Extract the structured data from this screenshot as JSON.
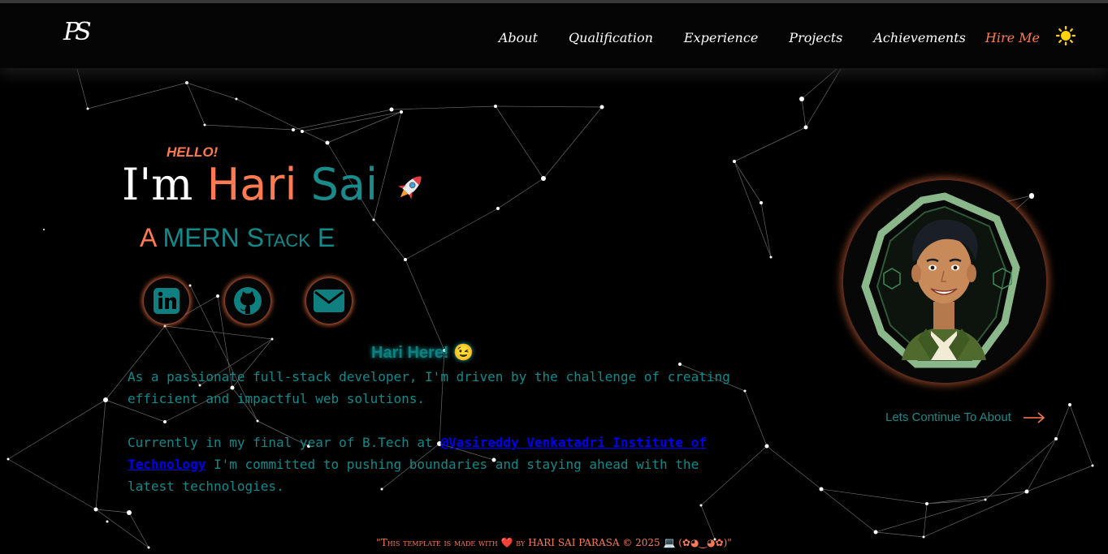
{
  "nav": {
    "logo": "PS",
    "links": [
      "About",
      "Qualification",
      "Experience",
      "Projects",
      "Achievements"
    ],
    "hire": "Hire Me",
    "theme_icon": "sun-icon"
  },
  "hero": {
    "hello": "HELLO!",
    "im": "I'm",
    "first_name": "Hari",
    "last_name": "Sai",
    "role_prefix": "A",
    "role_text": "MERN Stack E"
  },
  "social": [
    {
      "name": "linkedin-icon"
    },
    {
      "name": "github-icon"
    },
    {
      "name": "mail-icon"
    }
  ],
  "about": {
    "greeting": "Hari Here! 😉",
    "para1": "As a passionate full-stack developer, I'm driven by the challenge of creating efficient and impactful web solutions.",
    "para2_pre": "Currently in my final year of B.Tech at ",
    "para2_link": "@Vasireddy Venkatadri Institute of Technology",
    "para2_post": " I'm committed to pushing boundaries and staying ahead with the latest technologies."
  },
  "continue_label": "Lets Continue To About",
  "footer": "\"This template is made with ❤️ by HARI SAI PARASA © 2025 💻 (✿◕‿◕✿)\"",
  "colors": {
    "accent_orange": "#ff7a50",
    "accent_teal": "#128a8a",
    "background": "#000000"
  }
}
